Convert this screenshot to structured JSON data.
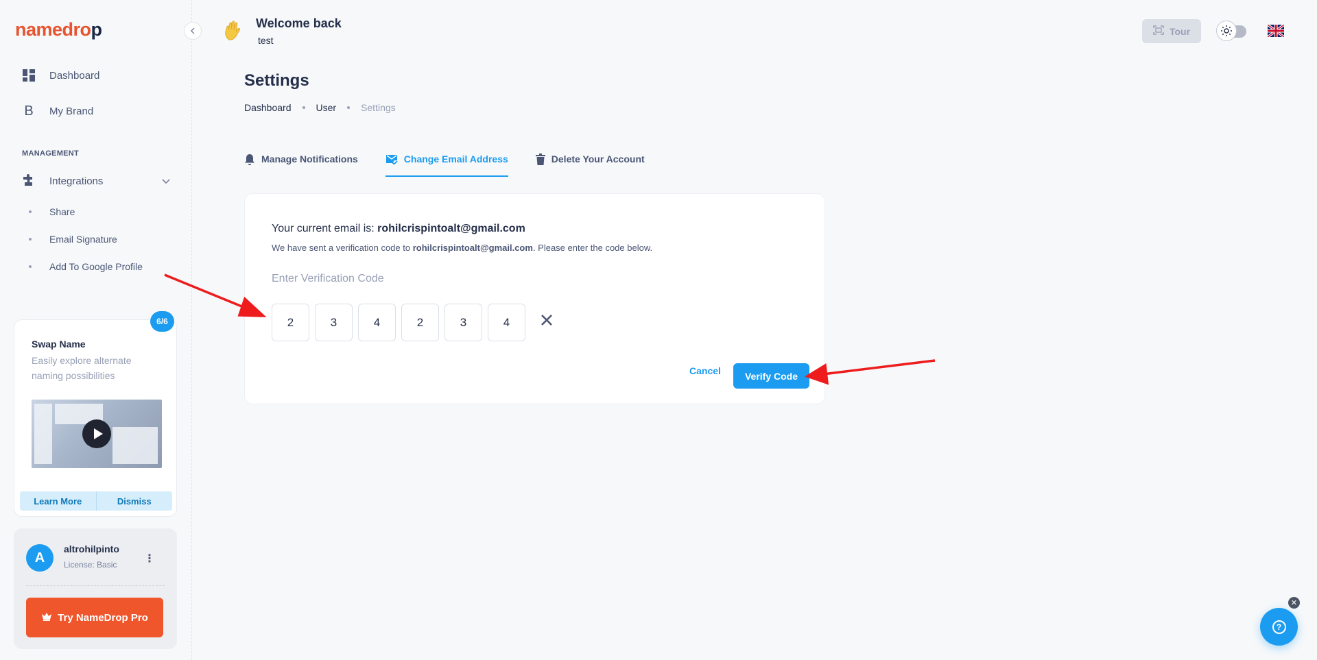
{
  "brand": {
    "logo_part1": "namedro",
    "logo_part2": "p"
  },
  "sidebar": {
    "items": [
      {
        "label": "Dashboard",
        "icon": "dashboard-icon"
      },
      {
        "label": "My Brand",
        "icon": "brand-b-icon"
      }
    ],
    "section_label": "MANAGEMENT",
    "integrations": {
      "label": "Integrations",
      "icon": "puzzle-icon"
    },
    "sub_items": [
      "Share",
      "Email Signature",
      "Add To Google Profile"
    ]
  },
  "promo": {
    "badge": "6/6",
    "title": "Swap Name",
    "description": "Easily explore alternate naming possibilities",
    "learn_more": "Learn More",
    "dismiss": "Dismiss"
  },
  "user": {
    "initial": "A",
    "name": "altrohilpinto",
    "license": "License: Basic",
    "pro_button": "Try NameDrop Pro"
  },
  "header": {
    "welcome": "Welcome back",
    "subtitle": "test",
    "tour": "Tour"
  },
  "page": {
    "title": "Settings",
    "breadcrumb": [
      "Dashboard",
      "User",
      "Settings"
    ]
  },
  "tabs": [
    {
      "label": "Manage Notifications",
      "icon": "bell-icon",
      "active": false
    },
    {
      "label": "Change Email Address",
      "icon": "mail-check-icon",
      "active": true
    },
    {
      "label": "Delete Your Account",
      "icon": "trash-icon",
      "active": false
    }
  ],
  "email_form": {
    "current_prefix": "Your current email is:",
    "current_email": "rohilcrispintoalt@gmail.com",
    "notice_prefix": "We have sent a verification code to",
    "notice_email": "rohilcrispintoalt@gmail.com",
    "notice_suffix": ". Please enter the code below.",
    "code_label": "Enter Verification Code",
    "code_digits": [
      "2",
      "3",
      "4",
      "2",
      "3",
      "4"
    ],
    "cancel": "Cancel",
    "verify": "Verify Code"
  },
  "help": {
    "label": "?"
  },
  "colors": {
    "accent": "#1b9cf0",
    "brand": "#f0562c",
    "arrow": "#ee1c1c"
  }
}
